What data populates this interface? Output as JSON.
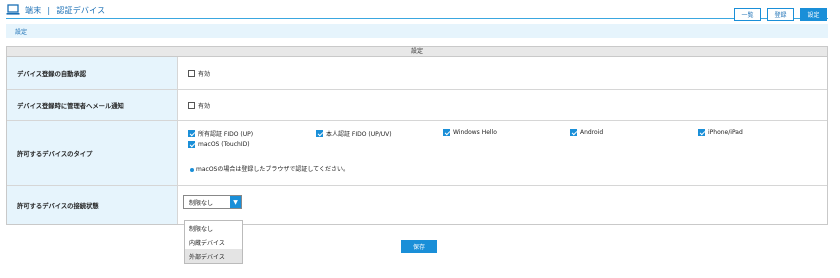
{
  "header": {
    "title_part1": "端末",
    "separator": "|",
    "title_part2": "認証デバイス",
    "buttons": [
      {
        "label": "一覧"
      },
      {
        "label": "登録"
      },
      {
        "label": "設定"
      }
    ]
  },
  "breadcrumb": "設定",
  "table": {
    "head": "設定",
    "rows": {
      "auto_approve": {
        "label": "デバイス登録の自動承認",
        "checkbox_label": "有効",
        "checked": false
      },
      "admin_notify": {
        "label": "デバイス登録時に管理者へメール通知",
        "checkbox_label": "有効",
        "checked": false
      },
      "device_types": {
        "label": "許可するデバイスのタイプ",
        "options": [
          {
            "label": "所有認証 FIDO (UP)",
            "checked": true
          },
          {
            "label": "本人認証 FIDO (UP/UV)",
            "checked": true
          },
          {
            "label": "Windows Hello",
            "checked": true
          },
          {
            "label": "Android",
            "checked": true
          },
          {
            "label": "iPhone/iPad",
            "checked": true
          },
          {
            "label": "macOS (TouchID)",
            "checked": true
          }
        ],
        "note": "macOSの場合は登録したブラウザで認証してください。"
      },
      "connection": {
        "label": "許可するデバイスの接続状態",
        "selected": "制限なし",
        "options": [
          "制限なし",
          "内蔵デバイス",
          "外部デバイス"
        ],
        "hovered_index": 2
      }
    }
  },
  "save_label": "保存",
  "colors": {
    "accent": "#1a8fd8",
    "label_bg": "#e6f4fc"
  },
  "icons": {
    "title": "laptop-icon",
    "select": "chevron-down-icon"
  }
}
